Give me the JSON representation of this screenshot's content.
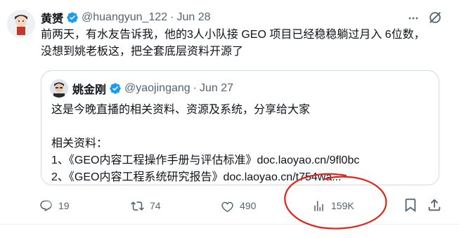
{
  "tweet": {
    "author_name": "黄赟",
    "author_handle": "@huangyun_122",
    "separator": "·",
    "date": "Jun 28",
    "lines": [
      "前两天，有水友告诉我，他的3人小队接 GEO 项目已经稳稳躺过月入 6位数，",
      "没想到姚老板这，把全套底层资料开源了"
    ]
  },
  "quote": {
    "author_name": "姚金刚",
    "author_handle": "@yaojingang",
    "separator": "·",
    "date": "Jun 27",
    "lines": [
      "这是今晚直播的相关资料、资源及系统，分享给大家",
      "",
      "相关资料：",
      "1、《GEO内容工程操作手册与评估标准》doc.laoyao.cn/9fl0bc",
      "2、《GEO内容工程系统研究报告》doc.laoyao.cn/t754wa..."
    ]
  },
  "actions": {
    "replies": "19",
    "reposts": "74",
    "likes": "490",
    "views": "159K"
  },
  "colors": {
    "verified": "#1d9bf0",
    "muted": "#536471",
    "annotation": "#e0241b"
  },
  "icons": [
    "more-icon",
    "grok-icon",
    "verified-icon",
    "reply-icon",
    "repost-icon",
    "like-icon",
    "views-icon",
    "bookmark-icon",
    "share-icon"
  ]
}
